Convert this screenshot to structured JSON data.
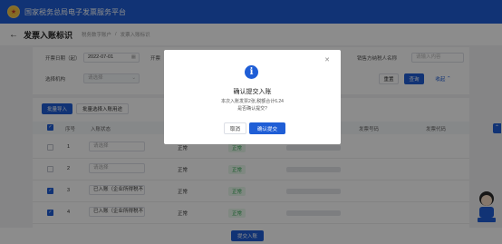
{
  "app": {
    "title": "国家税务总局电子发票服务平台"
  },
  "header": {
    "back_icon": "back-arrow-icon",
    "page_title": "发票入账标识",
    "breadcrumbs": [
      "税务数字账户",
      "/",
      "发票入账标识"
    ]
  },
  "filters": {
    "date_label": "开票日期（起）",
    "date_value": "2022-07-01",
    "date_end_label": "开票",
    "org_label": "选择机构",
    "org_placeholder": "请选择",
    "seller_label": "销售方纳税人名称",
    "seller_placeholder": "请输入内容",
    "reset_label": "重置",
    "query_label": "查询",
    "collapse_label": "收起"
  },
  "toolbar": {
    "import_label": "批量导入",
    "batch_mark_label": "批量选择入账用途"
  },
  "table": {
    "columns": [
      "序号",
      "入账状态",
      "",
      "",
      "发票号码",
      "发票代码"
    ],
    "rows": [
      {
        "checked": false,
        "index": "1",
        "status": "请选择",
        "normal": "正常",
        "flag": "正常"
      },
      {
        "checked": false,
        "index": "2",
        "status": "请选择",
        "normal": "正常",
        "flag": "正常"
      },
      {
        "checked": true,
        "index": "3",
        "status": "已入账（企业所得税不",
        "normal": "正常",
        "flag": "正常"
      },
      {
        "checked": true,
        "index": "4",
        "status": "已入账（企业所得税不",
        "normal": "正常",
        "flag": "正常"
      }
    ]
  },
  "bottom": {
    "submit_label": "提交入账"
  },
  "dialog": {
    "icon": "info-icon",
    "title": "确认提交入账",
    "description": "本次入账发票2张,税额合计6.24",
    "question": "是否确认提交?",
    "cancel_label": "取消",
    "confirm_label": "确认提交",
    "close_icon": "close-icon"
  },
  "colors": {
    "primary": "#1f5ed6",
    "success": "#2fa84f"
  }
}
